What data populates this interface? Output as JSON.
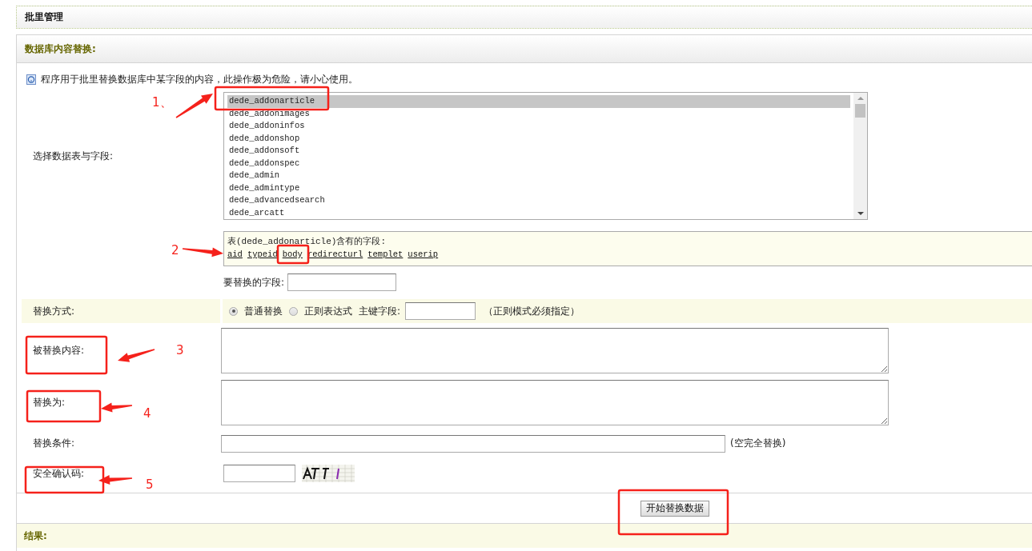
{
  "page_title": "批里管理",
  "section_title": "数据库内容替换:",
  "notice": "程序用于批里替换数据库中某字段的内容，此操作极为危险，请小心使用。",
  "table_select": {
    "label": "选择数据表与字段:",
    "tables": [
      {
        "name": "dede_addonarticle",
        "selected": true
      },
      {
        "name": "dede_addonimages",
        "selected": false
      },
      {
        "name": "dede_addoninfos",
        "selected": false
      },
      {
        "name": "dede_addonshop",
        "selected": false
      },
      {
        "name": "dede_addonsoft",
        "selected": false
      },
      {
        "name": "dede_addonspec",
        "selected": false
      },
      {
        "name": "dede_admin",
        "selected": false
      },
      {
        "name": "dede_admintype",
        "selected": false
      },
      {
        "name": "dede_advancedsearch",
        "selected": false
      },
      {
        "name": "dede_arcatt",
        "selected": false
      }
    ]
  },
  "fields_panel": {
    "caption": "表(dede_addonarticle)含有的字段:",
    "fields": [
      "aid",
      "typeid",
      "body",
      "redirecturl",
      "templet",
      "userip"
    ]
  },
  "field_input": {
    "label": "要替换的字段:"
  },
  "mode": {
    "label": "替换方式:",
    "options": [
      {
        "label": "普通替换",
        "selected": true
      },
      {
        "label": "正则表达式",
        "selected": false
      }
    ],
    "key_label": "主键字段:",
    "note": "（正则模式必须指定）"
  },
  "find": {
    "label": "被替换内容:"
  },
  "replace": {
    "label": "替换为:"
  },
  "condition": {
    "label": "替换条件:",
    "note": "(空完全替换)"
  },
  "captcha": {
    "label": "安全确认码:"
  },
  "submit": "开始替换数据",
  "result_title": "结果:",
  "annotations": [
    "1、",
    "2",
    "3",
    "4",
    "5"
  ]
}
